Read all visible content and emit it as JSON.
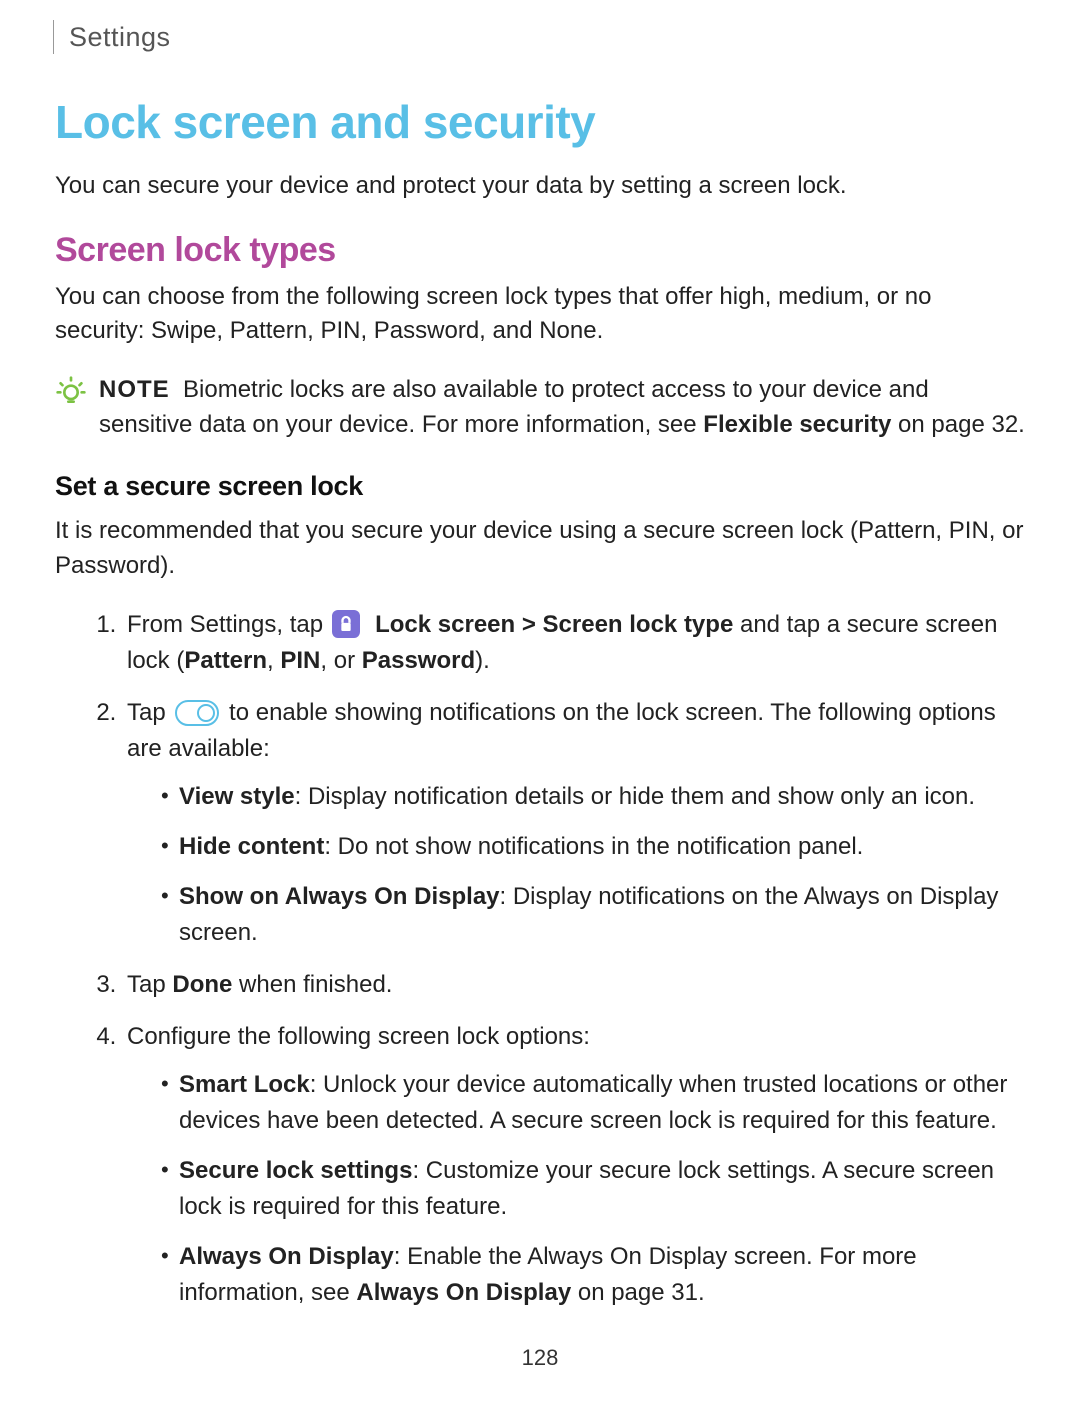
{
  "breadcrumb": "Settings",
  "h1": "Lock screen and security",
  "intro": "You can secure your device and protect your data by setting a screen lock.",
  "h2": "Screen lock types",
  "lock_types_text": "You can choose from the following screen lock types that offer high, medium, or no security: Swipe, Pattern, PIN, Password, and None.",
  "note": {
    "label": "NOTE",
    "text_before": "Biometric locks are also available to protect access to your device and sensitive data on your device. For more information, see ",
    "link": "Flexible security",
    "text_after": " on page 32."
  },
  "h3": "Set a secure screen lock",
  "secure_intro": "It is recommended that you secure your device using a secure screen lock (Pattern, PIN, or Password).",
  "steps": {
    "s1": {
      "a": "From Settings, tap ",
      "b": "Lock screen",
      "c": " > ",
      "d": "Screen lock type",
      "e": " and tap a secure screen lock (",
      "f": "Pattern",
      "g": ", ",
      "h": "PIN",
      "i": ", or ",
      "j": "Password",
      "k": ")."
    },
    "s2": {
      "a": "Tap ",
      "b": " to enable showing notifications on the lock screen. The following options are available:",
      "opts": {
        "o1_b": "View style",
        "o1_t": ": Display notification details or hide them and show only an icon.",
        "o2_b": "Hide content",
        "o2_t": ": Do not show notifications in the notification panel.",
        "o3_b": "Show on Always On Display",
        "o3_t": ": Display notifications on the Always on Display screen."
      }
    },
    "s3": {
      "a": "Tap ",
      "b": "Done",
      "c": " when finished."
    },
    "s4": {
      "a": "Configure the following screen lock options:",
      "opts": {
        "o1_b": "Smart Lock",
        "o1_t": ": Unlock your device automatically when trusted locations or other devices have been detected. A secure screen lock is required for this feature.",
        "o2_b": "Secure lock settings",
        "o2_t": ": Customize your secure lock settings. A secure screen lock is required for this feature.",
        "o3_b": "Always On Display",
        "o3_t_a": ": Enable the Always On Display screen. For more information, see ",
        "o3_link": "Always On Display",
        "o3_t_b": " on page 31."
      }
    }
  },
  "page_number": "128"
}
